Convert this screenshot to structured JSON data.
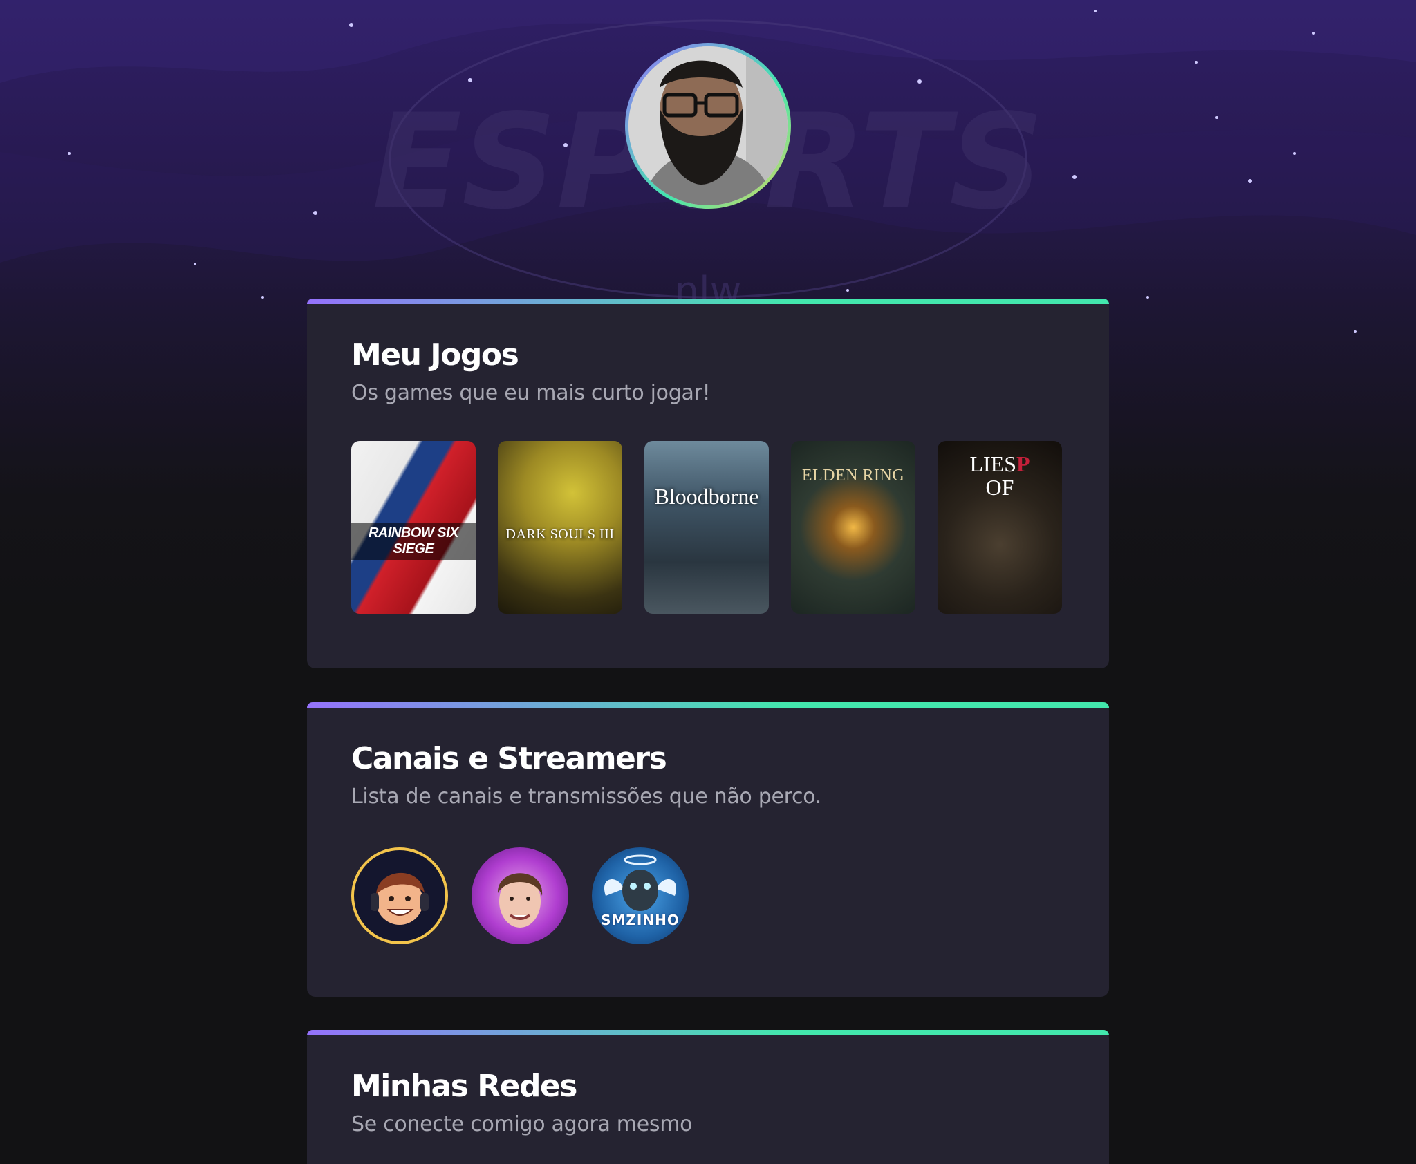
{
  "profile": {
    "avatar_alt": "Foto de perfil"
  },
  "background": {
    "watermark": "ESPORTS",
    "watermark_sub": "nlw"
  },
  "games_section": {
    "title": "Meu Jogos",
    "subtitle": "Os games que eu mais curto jogar!",
    "games": [
      {
        "name": "RAINBOW SIX SIEGE"
      },
      {
        "name": "DARK SOULS III"
      },
      {
        "name": "Bloodborne"
      },
      {
        "name": "ELDEN RING"
      },
      {
        "name": "LIES OF P",
        "title_top": "LIES",
        "title_bottom": "OF",
        "title_letter": "P"
      }
    ]
  },
  "streamers_section": {
    "title": "Canais e Streamers",
    "subtitle": "Lista de canais e transmissões que não perco.",
    "streamers": [
      {
        "icon": "cartoon-streamer-avatar"
      },
      {
        "icon": "streamer-photo-avatar"
      },
      {
        "icon": "smzinho-logo-avatar",
        "label": "SMZINHO"
      }
    ]
  },
  "social_section": {
    "title": "Minhas Redes",
    "subtitle": "Se conecte comigo agora mesmo"
  },
  "colors": {
    "background": "#121214",
    "card": "#252331",
    "accent_start": "#9572fc",
    "accent_end": "#43e7ad",
    "subtitle": "#a8a8b3"
  }
}
